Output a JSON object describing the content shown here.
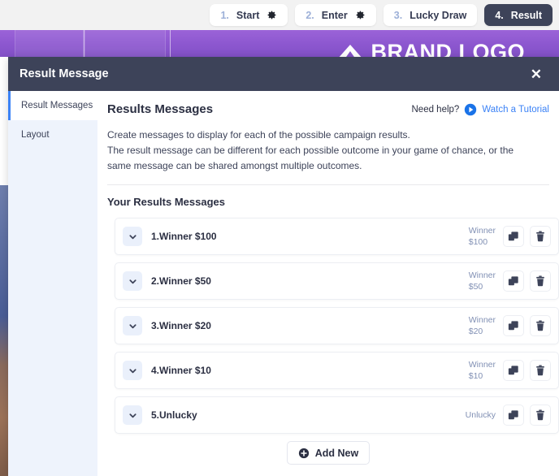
{
  "stepbar": {
    "steps": [
      {
        "num": "1.",
        "label": "Start",
        "has_gear": true,
        "active": false,
        "icon": "gear-icon"
      },
      {
        "num": "2.",
        "label": "Enter",
        "has_gear": true,
        "active": false,
        "icon": "gear-icon"
      },
      {
        "num": "3.",
        "label": "Lucky Draw",
        "has_gear": false,
        "active": false,
        "icon": ""
      },
      {
        "num": "4.",
        "label": "Result",
        "has_gear": false,
        "active": true,
        "icon": ""
      }
    ]
  },
  "banner": {
    "brand_text": "BRAND LOGO",
    "logo_icon": "brand-mark-icon",
    "background_color": "#8c57cf"
  },
  "modal": {
    "title": "Result Message",
    "close_icon": "close-icon",
    "sidebar": {
      "items": [
        {
          "label": "Result Messages",
          "active": true
        },
        {
          "label": "Layout",
          "active": false
        }
      ]
    },
    "content": {
      "section_title": "Results Messages",
      "help_label": "Need help?",
      "tutorial_label": "Watch a Tutorial",
      "tutorial_icon": "play-circle-icon",
      "description_line1": "Create messages to display for each of the possible campaign results.",
      "description_line2": "The result message can be different for each possible outcome in your game of chance, or the",
      "description_line3": "same message can be shared amongst multiple outcomes.",
      "subheading": "Your Results Messages",
      "rows": [
        {
          "label": "1.Winner $100",
          "tag_line1": "Winner",
          "tag_line2": "$100",
          "chevron_icon": "chevron-down-icon",
          "copy_icon": "copy-icon",
          "delete_icon": "trash-icon"
        },
        {
          "label": "2.Winner $50",
          "tag_line1": "Winner",
          "tag_line2": "$50",
          "chevron_icon": "chevron-down-icon",
          "copy_icon": "copy-icon",
          "delete_icon": "trash-icon"
        },
        {
          "label": "3.Winner $20",
          "tag_line1": "Winner",
          "tag_line2": "$20",
          "chevron_icon": "chevron-down-icon",
          "copy_icon": "copy-icon",
          "delete_icon": "trash-icon"
        },
        {
          "label": "4.Winner $10",
          "tag_line1": "Winner",
          "tag_line2": "$10",
          "chevron_icon": "chevron-down-icon",
          "copy_icon": "copy-icon",
          "delete_icon": "trash-icon"
        },
        {
          "label": "5.Unlucky",
          "tag_line1": "Unlucky",
          "tag_line2": "",
          "chevron_icon": "chevron-down-icon",
          "copy_icon": "copy-icon",
          "delete_icon": "trash-icon"
        }
      ],
      "add_new_label": "Add New",
      "add_new_icon": "plus-circle-icon"
    }
  },
  "colors": {
    "modal_header": "#3d4359",
    "accent_blue": "#3b82f6",
    "banner_purple": "#8c57cf",
    "tag_text": "#8190b4"
  }
}
